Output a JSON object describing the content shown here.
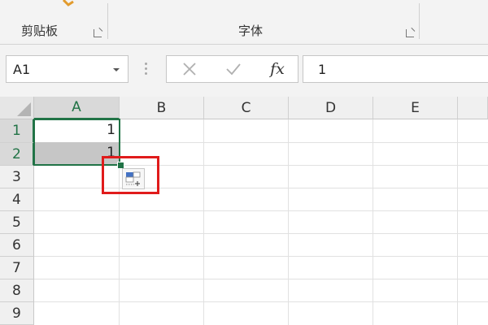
{
  "ribbon": {
    "groups": [
      {
        "label": "剪贴板"
      },
      {
        "label": "字体"
      }
    ]
  },
  "formula_bar": {
    "name_box_value": "A1",
    "fx_label": "fx",
    "formula_value": "1"
  },
  "grid": {
    "columns": [
      "A",
      "B",
      "C",
      "D",
      "E"
    ],
    "rows": [
      "1",
      "2",
      "3",
      "4",
      "5",
      "6",
      "7",
      "8",
      "9"
    ],
    "cells": {
      "A1": "1",
      "A2": "1"
    }
  },
  "colors": {
    "selection_green": "#217346",
    "highlight_red": "#e01b1b"
  },
  "icons": [
    "paste-icon",
    "dropdown-caret-icon",
    "cancel-icon",
    "enter-check-icon",
    "insert-function-icon",
    "autofill-options-icon",
    "dialog-launcher-icon"
  ]
}
